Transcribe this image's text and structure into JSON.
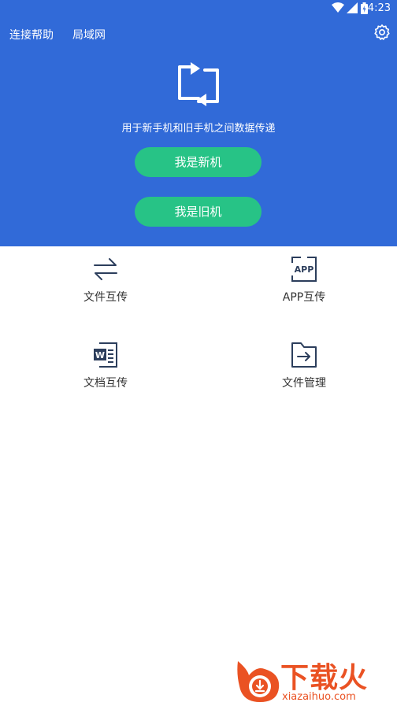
{
  "status_bar": {
    "time": "4:23",
    "icons": [
      "wifi-icon",
      "signal-icon",
      "battery-icon"
    ]
  },
  "header": {
    "links": [
      {
        "label": "连接帮助"
      },
      {
        "label": "局域网"
      }
    ],
    "settings_icon": "gear-icon"
  },
  "hero": {
    "logo_icon": "transfer-arrows-icon",
    "tagline": "用于新手机和旧手机之间数据传递",
    "buttons": [
      {
        "label": "我是新机"
      },
      {
        "label": "我是旧机"
      }
    ]
  },
  "tools": [
    {
      "label": "文件互传",
      "icon": "swap-arrows-icon"
    },
    {
      "label": "APP互传",
      "icon": "app-icon"
    },
    {
      "label": "文档互传",
      "icon": "word-doc-icon"
    },
    {
      "label": "文件管理",
      "icon": "folder-arrow-icon"
    }
  ],
  "watermark": {
    "brand": "下载火",
    "url": "xiazaihuo.com"
  },
  "colors": {
    "primary_blue": "#316ad8",
    "button_green": "#27c386",
    "icon_navy": "#2c3e5c",
    "watermark_orange": "#ea5223"
  }
}
